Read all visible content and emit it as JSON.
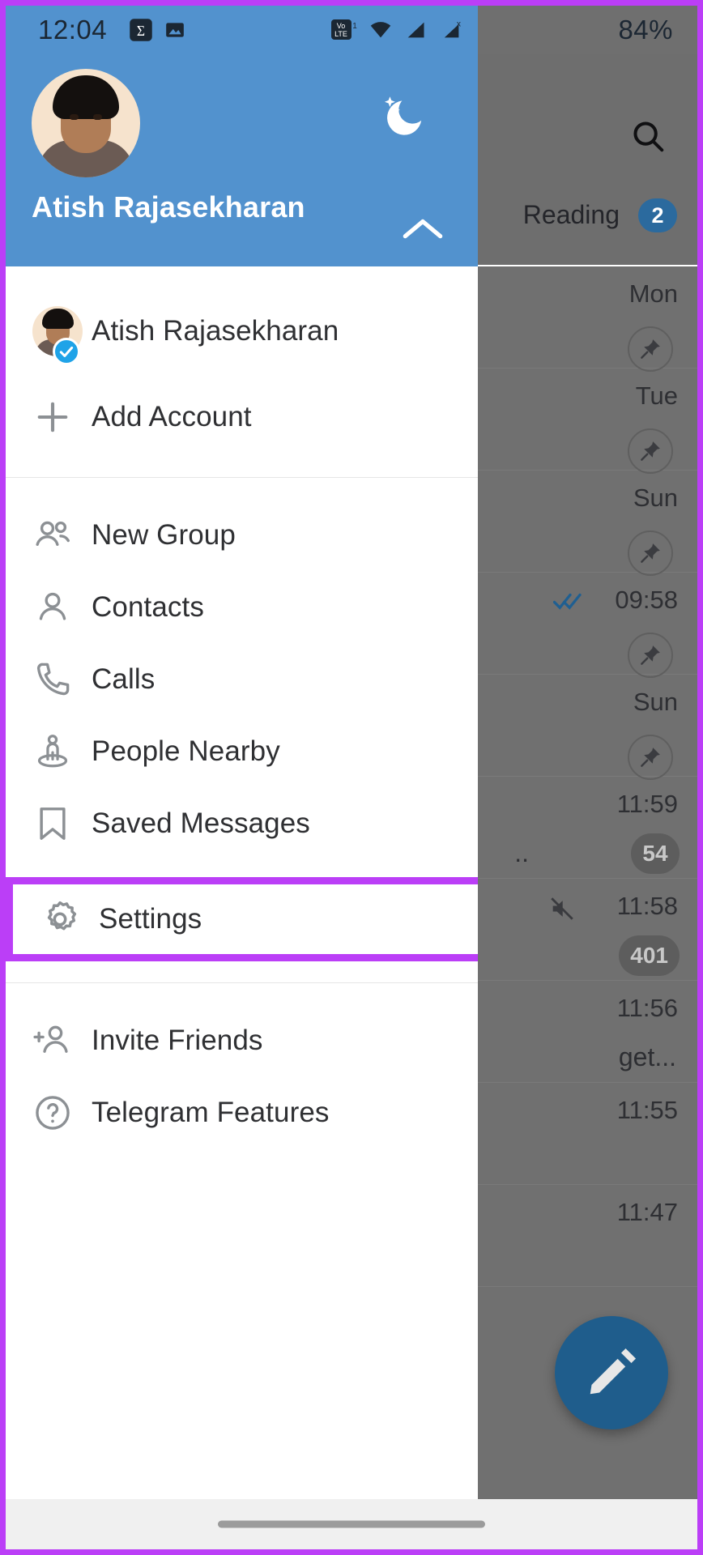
{
  "theme": {
    "accent_purple": "#bb3ef7",
    "header_blue": "#5292ce",
    "fab_blue": "#1f5d8c",
    "verified_blue": "#1fa3e8"
  },
  "status_bar": {
    "time": "12:04",
    "battery": "84%",
    "icons": [
      "sigma-notification-icon",
      "image-notification-icon",
      "volte-icon",
      "wifi-icon",
      "signal-bar-icon",
      "signal-x-icon"
    ]
  },
  "drawer": {
    "profile": {
      "name": "Atish Rajasekharan",
      "avatar_name": "profile-avatar",
      "night_mode_icon": "moon-icon",
      "expand_icon": "chevron-up-icon"
    },
    "accounts": [
      {
        "label": "Atish Rajasekharan",
        "icon": "account-avatar",
        "verified": true
      },
      {
        "label": "Add Account",
        "icon": "plus-icon",
        "verified": false
      }
    ],
    "items": [
      {
        "label": "New Group",
        "icon": "people-group-icon"
      },
      {
        "label": "Contacts",
        "icon": "person-icon"
      },
      {
        "label": "Calls",
        "icon": "phone-icon"
      },
      {
        "label": "People Nearby",
        "icon": "people-nearby-icon"
      },
      {
        "label": "Saved Messages",
        "icon": "bookmark-icon"
      }
    ],
    "highlighted": {
      "label": "Settings",
      "icon": "gear-icon"
    },
    "footer_items": [
      {
        "label": "Invite Friends",
        "icon": "person-add-icon"
      },
      {
        "label": "Telegram Features",
        "icon": "question-circle-icon"
      }
    ]
  },
  "background_app": {
    "search_icon": "search-icon",
    "folder_tab": {
      "label": "Reading",
      "badge": "2"
    },
    "compose_icon": "pencil-icon",
    "chat_rows": [
      {
        "time": "Mon",
        "pin": true
      },
      {
        "time": "Tue",
        "pin": true
      },
      {
        "time": "Sun",
        "pin": true
      },
      {
        "time": "09:58",
        "pin": true,
        "ticks": "double-check-icon"
      },
      {
        "time": "Sun",
        "pin": true
      },
      {
        "time": "11:59",
        "count": "54",
        "snippet": ".."
      },
      {
        "time": "11:58",
        "count": "401",
        "mute": "mute-icon"
      },
      {
        "time": "11:56",
        "snippet": "get..."
      },
      {
        "time": "11:55"
      },
      {
        "time": "11:47"
      }
    ]
  }
}
